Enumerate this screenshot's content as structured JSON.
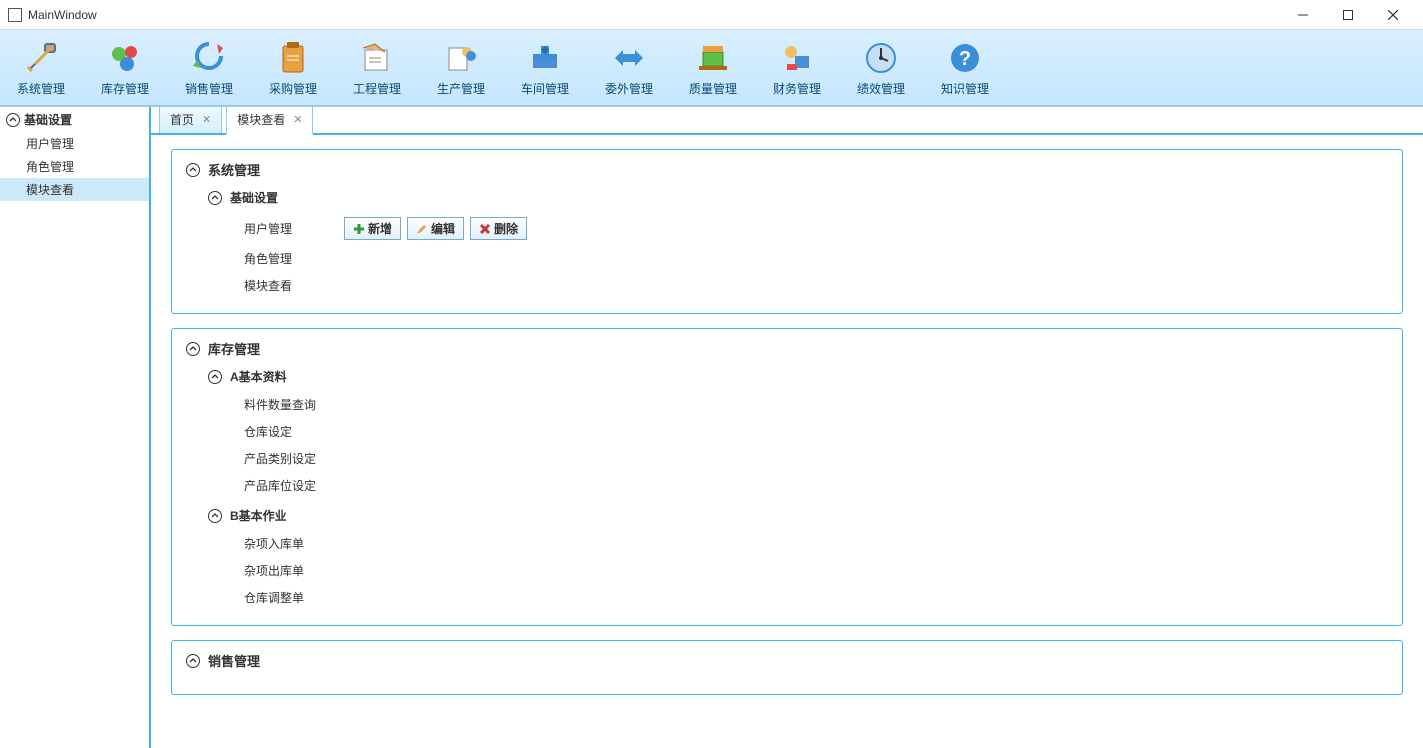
{
  "window": {
    "title": "MainWindow"
  },
  "toolbar": [
    {
      "id": "sys",
      "label": "系统管理"
    },
    {
      "id": "inv",
      "label": "库存管理"
    },
    {
      "id": "sales",
      "label": "销售管理"
    },
    {
      "id": "purchase",
      "label": "采购管理"
    },
    {
      "id": "eng",
      "label": "工程管理"
    },
    {
      "id": "prod",
      "label": "生产管理"
    },
    {
      "id": "shop",
      "label": "车间管理"
    },
    {
      "id": "outsrc",
      "label": "委外管理"
    },
    {
      "id": "quality",
      "label": "质量管理"
    },
    {
      "id": "finance",
      "label": "财务管理"
    },
    {
      "id": "perf",
      "label": "绩效管理"
    },
    {
      "id": "know",
      "label": "知识管理"
    }
  ],
  "sidebar": {
    "header": "基础设置",
    "items": [
      {
        "label": "用户管理",
        "selected": false
      },
      {
        "label": "角色管理",
        "selected": false
      },
      {
        "label": "模块查看",
        "selected": true
      }
    ]
  },
  "tabs": [
    {
      "label": "首页",
      "active": false
    },
    {
      "label": "模块查看",
      "active": true
    }
  ],
  "actions": {
    "add": "新增",
    "edit": "编辑",
    "delete": "删除"
  },
  "modules": [
    {
      "title": "系统管理",
      "groups": [
        {
          "title": "基础设置",
          "items": [
            "用户管理",
            "角色管理",
            "模块查看"
          ],
          "showActionsOn": 0
        }
      ]
    },
    {
      "title": "库存管理",
      "groups": [
        {
          "title": "A基本资料",
          "items": [
            "料件数量查询",
            "仓库设定",
            "产品类别设定",
            "产品库位设定"
          ]
        },
        {
          "title": "B基本作业",
          "items": [
            "杂项入库单",
            "杂项出库单",
            "仓库调整单"
          ]
        }
      ]
    },
    {
      "title": "销售管理",
      "groups": []
    }
  ]
}
